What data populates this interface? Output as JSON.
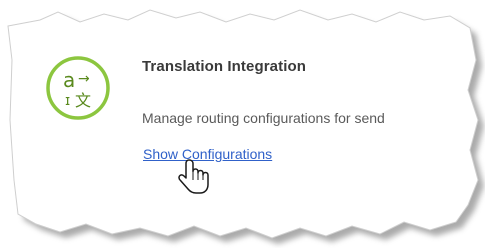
{
  "card": {
    "title": "Translation Integration",
    "description": "Manage routing configurations for send",
    "link_label": "Show Configurations",
    "icon": "translate-icon",
    "icon_glyph_latin": "a",
    "icon_glyph_cjk": "文",
    "icon_glyph_arrow": "→",
    "icon_glyph_marker": "ɪ"
  },
  "cursor": {
    "icon": "hand-pointer-icon"
  },
  "colors": {
    "icon_ring": "#8cc63f",
    "icon_text": "#5a8a1e",
    "link": "#3061c9",
    "title": "#3a3a3a",
    "description": "#5a5a5a",
    "edge_shadow": "#9a9a9a"
  }
}
